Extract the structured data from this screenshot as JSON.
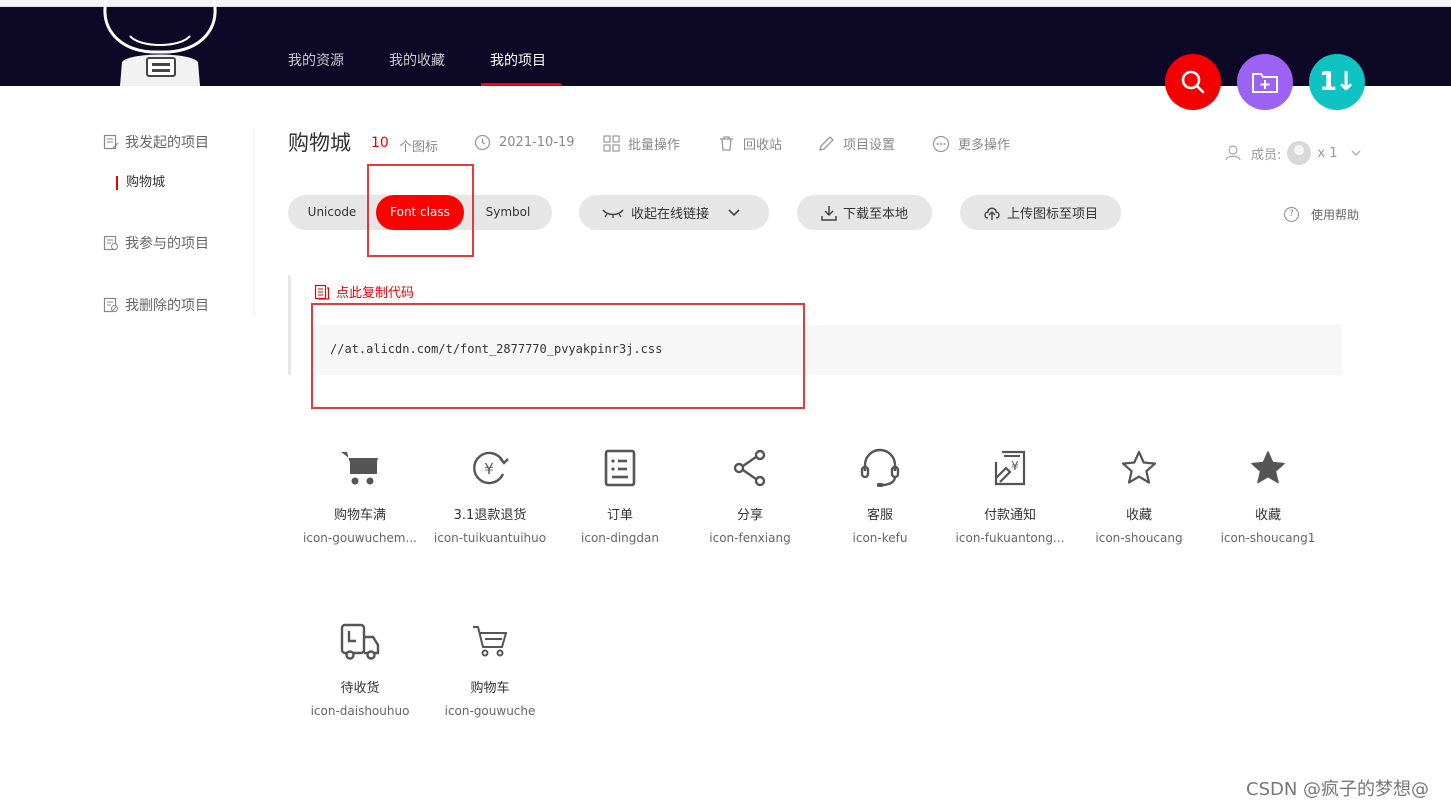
{
  "header": {
    "nav": [
      {
        "label": "我的资源"
      },
      {
        "label": "我的收藏"
      },
      {
        "label": "我的项目",
        "active": true
      }
    ],
    "fab_icons": [
      "search-icon",
      "add-folder-icon",
      "sort-icon"
    ],
    "fab_sort_text": "1↓",
    "colors": {
      "bg": "#0c0826",
      "search": "#f40000",
      "folder": "#9c62f4",
      "sort": "#10c3c3"
    }
  },
  "sidebar": {
    "items": [
      {
        "label": "我发起的项目",
        "icon": "project-icon"
      },
      {
        "label": "我参与的项目",
        "icon": "project-join-icon"
      },
      {
        "label": "我删除的项目",
        "icon": "project-delete-icon"
      }
    ],
    "sub_item": "购物城"
  },
  "project": {
    "title": "购物城",
    "count": "10",
    "count_label": "个图标",
    "date": "2021-10-19",
    "tools": [
      "批量操作",
      "回收站",
      "项目设置",
      "更多操作"
    ],
    "members_label": "成员:",
    "members_count": "x 1"
  },
  "tabs": {
    "items": [
      "Unicode",
      "Font class",
      "Symbol"
    ],
    "active": "Font class"
  },
  "actions": {
    "collapse_link": "收起在线链接",
    "download": "下载至本地",
    "upload": "上传图标至项目",
    "help": "使用帮助"
  },
  "code": {
    "copy_label": "点此复制代码",
    "url": "//at.alicdn.com/t/font_2877770_pvyakpinr3j.css"
  },
  "icons": [
    {
      "name": "购物车满",
      "class": "icon-gouwuchem...",
      "glyph": "cart-full-icon"
    },
    {
      "name": "3.1退款退货",
      "class": "icon-tuikuantuihuo",
      "glyph": "refund-icon"
    },
    {
      "name": "订单",
      "class": "icon-dingdan",
      "glyph": "order-icon"
    },
    {
      "name": "分享",
      "class": "icon-fenxiang",
      "glyph": "share-icon"
    },
    {
      "name": "客服",
      "class": "icon-kefu",
      "glyph": "headset-icon"
    },
    {
      "name": "付款通知",
      "class": "icon-fukuantong...",
      "glyph": "payment-notice-icon"
    },
    {
      "name": "收藏",
      "class": "icon-shoucang",
      "glyph": "star-outline-icon"
    },
    {
      "name": "收藏",
      "class": "icon-shoucang1",
      "glyph": "star-filled-icon"
    },
    {
      "name": "待收货",
      "class": "icon-daishouhuo",
      "glyph": "delivery-truck-icon"
    },
    {
      "name": "购物车",
      "class": "icon-gouwuche",
      "glyph": "cart-icon"
    }
  ],
  "watermark": "CSDN @疯子的梦想@"
}
